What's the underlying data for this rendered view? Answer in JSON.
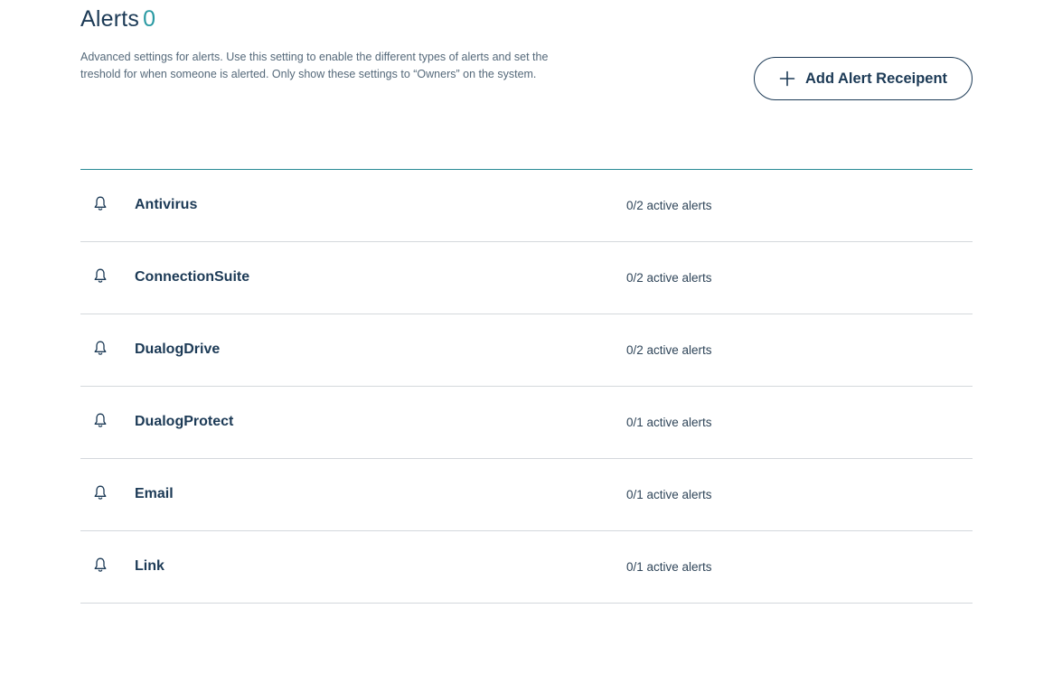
{
  "header": {
    "title": "Alerts",
    "count": "0",
    "description": "Advanced settings for alerts. Use this setting to enable the different types of alerts and set the treshold for when someone is alerted. Only show these settings to “Owners” on the system.",
    "add_button_label": "Add Alert Receipent",
    "add_button_icon": "plus-icon"
  },
  "alerts": [
    {
      "name": "Antivirus",
      "status": "0/2 active alerts",
      "icon": "bell-icon"
    },
    {
      "name": "ConnectionSuite",
      "status": "0/2 active alerts",
      "icon": "bell-icon"
    },
    {
      "name": "DualogDrive",
      "status": "0/2 active alerts",
      "icon": "bell-icon"
    },
    {
      "name": "DualogProtect",
      "status": "0/1 active alerts",
      "icon": "bell-icon"
    },
    {
      "name": "Email",
      "status": "0/1 active alerts",
      "icon": "bell-icon"
    },
    {
      "name": "Link",
      "status": "0/1 active alerts",
      "icon": "bell-icon"
    }
  ],
  "colors": {
    "primary_text": "#1c3a56",
    "accent": "#2a9aa3",
    "divider": "#d4d8dc",
    "header_rule": "#2a8a96"
  }
}
